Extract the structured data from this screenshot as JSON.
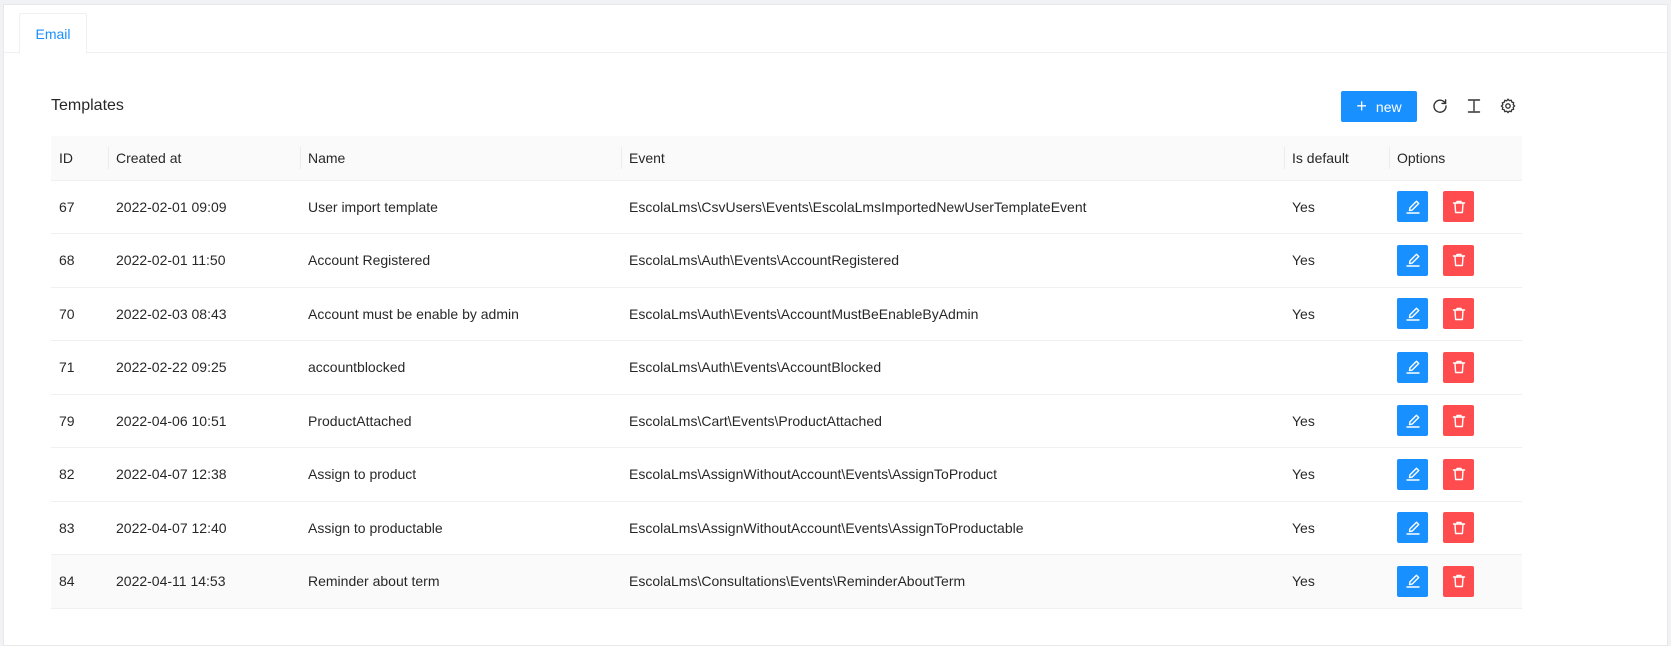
{
  "tabs": [
    {
      "label": "Email",
      "active": true
    }
  ],
  "card": {
    "title": "Templates"
  },
  "toolbar": {
    "new_label": "new",
    "icons": [
      "reload-icon",
      "column-height-icon",
      "setting-icon"
    ]
  },
  "colors": {
    "primary": "#1890ff",
    "danger": "#ff4d4f"
  },
  "table": {
    "columns": [
      "ID",
      "Created at",
      "Name",
      "Event",
      "Is default",
      "Options"
    ],
    "rows": [
      {
        "id": "67",
        "created_at": "2022-02-01 09:09",
        "name": "User import template",
        "event": "EscolaLms\\CsvUsers\\Events\\EscolaLmsImportedNewUserTemplateEvent",
        "is_default": "Yes"
      },
      {
        "id": "68",
        "created_at": "2022-02-01 11:50",
        "name": "Account Registered",
        "event": "EscolaLms\\Auth\\Events\\AccountRegistered",
        "is_default": "Yes"
      },
      {
        "id": "70",
        "created_at": "2022-02-03 08:43",
        "name": "Account must be enable by admin",
        "event": "EscolaLms\\Auth\\Events\\AccountMustBeEnableByAdmin",
        "is_default": "Yes"
      },
      {
        "id": "71",
        "created_at": "2022-02-22 09:25",
        "name": "accountblocked",
        "event": "EscolaLms\\Auth\\Events\\AccountBlocked",
        "is_default": ""
      },
      {
        "id": "79",
        "created_at": "2022-04-06 10:51",
        "name": "ProductAttached",
        "event": "EscolaLms\\Cart\\Events\\ProductAttached",
        "is_default": "Yes"
      },
      {
        "id": "82",
        "created_at": "2022-04-07 12:38",
        "name": "Assign to product",
        "event": "EscolaLms\\AssignWithoutAccount\\Events\\AssignToProduct",
        "is_default": "Yes"
      },
      {
        "id": "83",
        "created_at": "2022-04-07 12:40",
        "name": "Assign to productable",
        "event": "EscolaLms\\AssignWithoutAccount\\Events\\AssignToProductable",
        "is_default": "Yes"
      },
      {
        "id": "84",
        "created_at": "2022-04-11 14:53",
        "name": "Reminder about term",
        "event": "EscolaLms\\Consultations\\Events\\ReminderAboutTerm",
        "is_default": "Yes"
      }
    ]
  }
}
